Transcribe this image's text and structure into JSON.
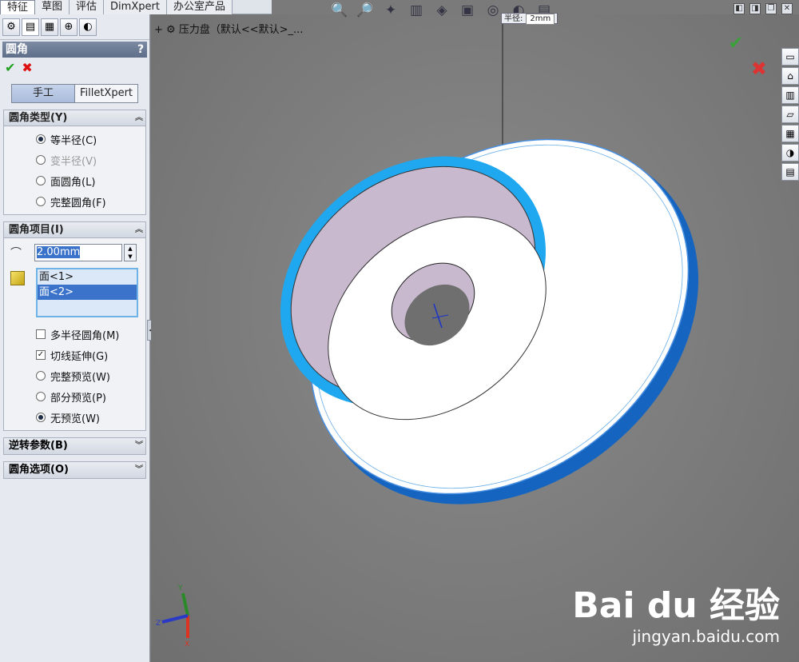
{
  "tabs": [
    "特征",
    "草图",
    "评估",
    "DimXpert",
    "办公室产品"
  ],
  "panel": {
    "title": "圆角",
    "help": "?",
    "ok_symbol": "✔",
    "cancel_symbol": "✖",
    "modes": [
      "手工",
      "FilletXpert"
    ],
    "fillet_type": {
      "header": "圆角类型(Y)",
      "options": [
        {
          "label": "等半径(C)",
          "selected": true,
          "disabled": false
        },
        {
          "label": "变半径(V)",
          "selected": false,
          "disabled": true
        },
        {
          "label": "面圆角(L)",
          "selected": false,
          "disabled": false
        },
        {
          "label": "完整圆角(F)",
          "selected": false,
          "disabled": false
        }
      ]
    },
    "fillet_items": {
      "header": "圆角项目(I)",
      "radius_value": "2.00mm",
      "faces": [
        "面<1>",
        "面<2>"
      ],
      "multi_radius": "多半径圆角(M)",
      "tangent": "切线延伸(G)",
      "full_preview": "完整预览(W)",
      "partial_preview": "部分预览(P)",
      "no_preview": "无预览(W)"
    },
    "reverse_params": "逆转参数(B)",
    "fillet_options": "圆角选项(O)"
  },
  "viewport": {
    "tree_label": "压力盘（默认<<默认>_...",
    "dim_label": "半径:",
    "dim_value": "2mm",
    "axis_x": "X",
    "axis_y": "Y",
    "axis_z": "Z",
    "watermark_logo": "Bai du 经验",
    "watermark_url": "jingyan.baidu.com"
  },
  "colors": {
    "accent_blue": "#1fa8f0",
    "disc_white": "#ffffff",
    "disc_edge": "#1565c0",
    "inner_wall": "#c9b9cf"
  }
}
